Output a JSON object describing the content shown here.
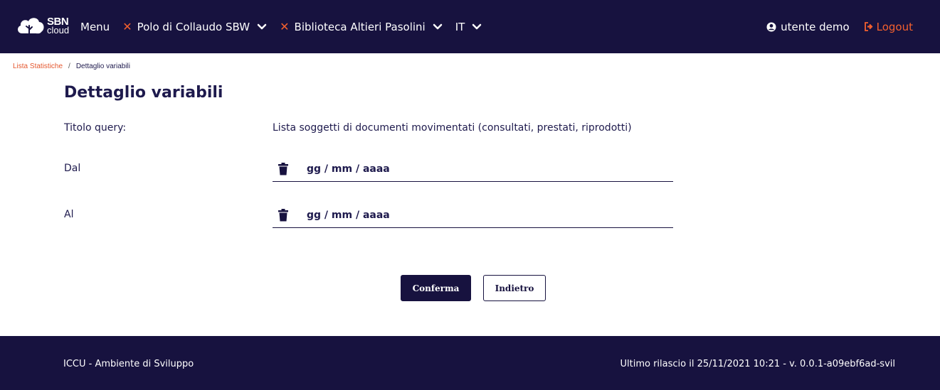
{
  "header": {
    "logo_top": "SBN",
    "logo_bottom": "cloud",
    "menu_label": "Menu",
    "polo_label": "Polo di Collaudo SBW",
    "biblioteca_label": "Biblioteca Altieri Pasolini",
    "language_label": "IT",
    "user_label": "utente demo",
    "logout_label": "Logout",
    "accent_color": "#f4602e",
    "bg_color": "#17123f"
  },
  "breadcrumb": {
    "parent": "Lista Statistiche",
    "separator": "/",
    "current": "Dettaglio variabili"
  },
  "main": {
    "title": "Dettaglio variabili",
    "query_label": "Titolo query:",
    "query_value": "Lista soggetti di documenti movimentati (consultati, prestati, riprodotti)",
    "from_label": "Dal",
    "from_placeholder": "gg / mm / aaaa",
    "to_label": "Al",
    "to_placeholder": "gg / mm / aaaa",
    "confirm_label": "Conferma",
    "back_label": "Indietro"
  },
  "footer": {
    "left": "ICCU - Ambiente di Sviluppo",
    "right": "Ultimo rilascio il 25/11/2021 10:21 - v. 0.0.1-a09ebf6ad-svil"
  }
}
